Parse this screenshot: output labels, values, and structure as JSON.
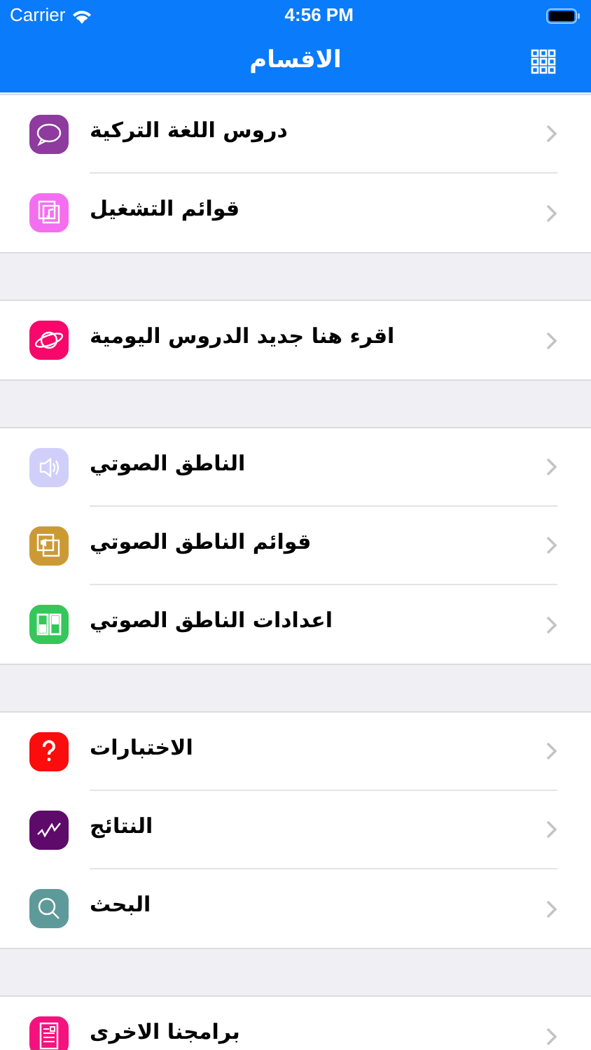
{
  "status_bar": {
    "carrier": "Carrier",
    "time": "4:56 PM"
  },
  "nav_bar": {
    "title": "الاقسام"
  },
  "sections": [
    {
      "items": [
        {
          "label": "دروس اللغة التركية",
          "kind": "chat",
          "color": "#8e3a9e"
        },
        {
          "label": "قوائم التشغيل",
          "kind": "music",
          "color": "#f46ff0"
        }
      ]
    },
    {
      "items": [
        {
          "label": "اقرء هنا جديد الدروس اليومية",
          "kind": "planet",
          "color": "#f7086a"
        }
      ]
    },
    {
      "items": [
        {
          "label": "الناطق الصوتي",
          "kind": "speaker",
          "color": "#cfcffa"
        },
        {
          "label": "قوائم الناطق الصوتي",
          "kind": "speaker-pages",
          "color": "#cc9a35"
        },
        {
          "label": "اعدادات الناطق الصوتي",
          "kind": "panels",
          "color": "#34c759"
        }
      ]
    },
    {
      "items": [
        {
          "label": "الاختبارات",
          "kind": "question",
          "color": "#fb0d0d"
        },
        {
          "label": "النتائج",
          "kind": "chart",
          "color": "#5e0a6a"
        },
        {
          "label": "البحث",
          "kind": "search",
          "color": "#5f9a9a"
        }
      ]
    },
    {
      "items": [
        {
          "label": "برامجنا الاخرى",
          "kind": "document",
          "color": "#f5127e"
        }
      ]
    }
  ]
}
